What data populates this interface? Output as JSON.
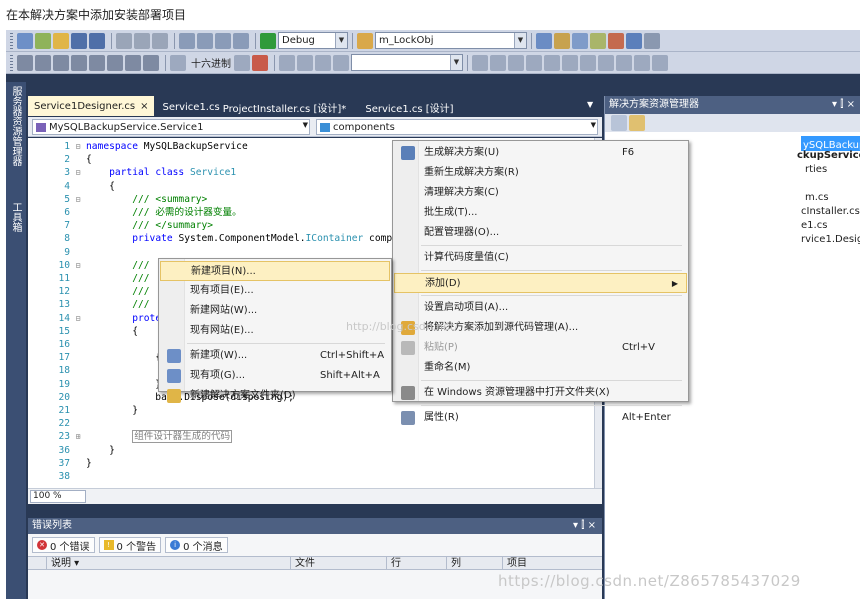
{
  "caption": "在本解决方案中添加安装部署项目",
  "toolbar": {
    "config_value": "Debug",
    "find_value": "m_LockObj",
    "hex_label": "十六进制"
  },
  "left_strip": {
    "server_explorer": "服务器资源管理器",
    "toolbox": "工具箱"
  },
  "tabs": [
    {
      "label": "Service1Designer.cs",
      "active": true,
      "close": "×"
    },
    {
      "label": "Service1.cs"
    },
    {
      "label": "ProjectInstaller.cs [设计]*"
    },
    {
      "label": "Service1.cs [设计]"
    }
  ],
  "navbar": {
    "class_combo": "MySQLBackupService.Service1",
    "member_combo": "components"
  },
  "code_lines": [
    {
      "n": "1",
      "fold": "⊟",
      "t": [
        [
          "kw",
          "namespace "
        ],
        [
          "pl",
          "MySQLBackupService"
        ]
      ]
    },
    {
      "n": "2",
      "fold": "",
      "t": [
        [
          "pl",
          "{"
        ]
      ]
    },
    {
      "n": "3",
      "fold": "⊟",
      "t": [
        [
          "pl",
          "    "
        ],
        [
          "kw",
          "partial class "
        ],
        [
          "ty",
          "Service1"
        ]
      ]
    },
    {
      "n": "4",
      "fold": "",
      "t": [
        [
          "pl",
          "    {"
        ]
      ]
    },
    {
      "n": "5",
      "fold": "⊟",
      "t": [
        [
          "pl",
          "        "
        ],
        [
          "cm",
          "/// <summary>"
        ]
      ]
    },
    {
      "n": "6",
      "fold": "",
      "t": [
        [
          "pl",
          "        "
        ],
        [
          "cm",
          "/// 必需的设计器变量。"
        ]
      ]
    },
    {
      "n": "7",
      "fold": "",
      "t": [
        [
          "pl",
          "        "
        ],
        [
          "cm",
          "/// </summary>"
        ]
      ]
    },
    {
      "n": "8",
      "fold": "",
      "t": [
        [
          "pl",
          "        "
        ],
        [
          "kw",
          "private "
        ],
        [
          "pl",
          "System.ComponentModel."
        ],
        [
          "ty",
          "IContainer"
        ],
        [
          "pl",
          " comp"
        ]
      ]
    },
    {
      "n": "9",
      "fold": "",
      "t": [
        [
          "pl",
          ""
        ]
      ]
    },
    {
      "n": "10",
      "fold": "⊟",
      "t": [
        [
          "pl",
          "        "
        ],
        [
          "cm",
          "///"
        ]
      ]
    },
    {
      "n": "11",
      "fold": "",
      "t": [
        [
          "pl",
          "        "
        ],
        [
          "cm",
          "///"
        ]
      ]
    },
    {
      "n": "12",
      "fold": "",
      "t": [
        [
          "pl",
          "        "
        ],
        [
          "cm",
          "///"
        ]
      ]
    },
    {
      "n": "13",
      "fold": "",
      "t": [
        [
          "pl",
          "        "
        ],
        [
          "cm",
          "///"
        ]
      ]
    },
    {
      "n": "14",
      "fold": "⊟",
      "t": [
        [
          "pl",
          "        "
        ],
        [
          "kw",
          "prote"
        ]
      ]
    },
    {
      "n": "15",
      "fold": "",
      "t": [
        [
          "pl",
          "        {"
        ]
      ]
    },
    {
      "n": "16",
      "fold": "",
      "t": [
        [
          "pl",
          ""
        ]
      ]
    },
    {
      "n": "17",
      "fold": "",
      "t": [
        [
          "pl",
          "            {"
        ]
      ]
    },
    {
      "n": "18",
      "fold": "",
      "t": [
        [
          "pl",
          ""
        ]
      ]
    },
    {
      "n": "19",
      "fold": "",
      "t": [
        [
          "pl",
          "            }"
        ]
      ]
    },
    {
      "n": "20",
      "fold": "",
      "t": [
        [
          "pl",
          "            base.Dispose(disposing);"
        ]
      ]
    },
    {
      "n": "21",
      "fold": "",
      "t": [
        [
          "pl",
          "        }"
        ]
      ]
    },
    {
      "n": "22",
      "fold": "",
      "t": [
        [
          "pl",
          ""
        ]
      ]
    },
    {
      "n": "23",
      "fold": "⊞",
      "t": [
        [
          "pl",
          "        "
        ],
        [
          "region",
          "组件设计器生成的代码"
        ]
      ]
    },
    {
      "n": "36",
      "fold": "",
      "t": [
        [
          "pl",
          "    }"
        ]
      ]
    },
    {
      "n": "37",
      "fold": "",
      "t": [
        [
          "pl",
          "}"
        ]
      ]
    },
    {
      "n": "38",
      "fold": "",
      "t": [
        [
          "pl",
          ""
        ]
      ]
    }
  ],
  "zoom": "100 %",
  "error_list": {
    "title": "错误列表",
    "pin": "▾ ⫿ ×",
    "errors": "0 个错误",
    "warnings": "0 个警告",
    "messages": "0 个消息",
    "columns": [
      "说明",
      "文件",
      "行",
      "列",
      "项目"
    ]
  },
  "solution_explorer": {
    "title": "解决方案资源管理器",
    "pin": "▾ ⫿ ×",
    "items": [
      {
        "text": "ySQLBackupService\" (1 个项目)"
      },
      {
        "text": "ckupService",
        "bold": true
      },
      {
        "text": "rties"
      },
      {
        "text": "m.cs"
      },
      {
        "text": "cInstaller.cs"
      },
      {
        "text": "e1.cs"
      },
      {
        "text": "rvice1.Designer.cs"
      }
    ]
  },
  "context_menu": {
    "items": [
      {
        "label": "生成解决方案(U)",
        "shortcut": "F6",
        "icon": "build-icon"
      },
      {
        "label": "重新生成解决方案(R)"
      },
      {
        "label": "清理解决方案(C)"
      },
      {
        "label": "批生成(T)..."
      },
      {
        "label": "配置管理器(O)..."
      },
      {
        "sep": true
      },
      {
        "label": "计算代码度量值(C)"
      },
      {
        "sep": true
      },
      {
        "label": "添加(D)",
        "submenu": true,
        "highlight": true
      },
      {
        "sep": true
      },
      {
        "label": "设置启动项目(A)..."
      },
      {
        "label": "将解决方案添加到源代码管理(A)...",
        "icon": "source-control-icon"
      },
      {
        "label": "粘贴(P)",
        "shortcut": "Ctrl+V",
        "disabled": true,
        "icon": "paste-icon"
      },
      {
        "label": "重命名(M)"
      },
      {
        "sep": true
      },
      {
        "label": "在 Windows 资源管理器中打开文件夹(X)",
        "icon": "open-folder-icon"
      },
      {
        "sep": true
      },
      {
        "label": "属性(R)",
        "shortcut": "Alt+Enter",
        "icon": "properties-icon"
      }
    ]
  },
  "submenu": {
    "items": [
      {
        "label": "新建项目(N)...",
        "highlight": true
      },
      {
        "label": "现有项目(E)..."
      },
      {
        "label": "新建网站(W)..."
      },
      {
        "label": "现有网站(E)..."
      },
      {
        "sep": true
      },
      {
        "label": "新建项(W)...",
        "shortcut": "Ctrl+Shift+A",
        "icon": "new-item-icon"
      },
      {
        "label": "现有项(G)...",
        "shortcut": "Shift+Alt+A",
        "icon": "existing-item-icon"
      },
      {
        "label": "新建解决方案文件夹(D)",
        "icon": "new-folder-icon"
      }
    ]
  },
  "watermark": "https://blog.csdn.net/Z865785437029",
  "watermark_short": "http://blog.csdn.net/",
  "colors": {
    "chrome": "#293955",
    "toolbar": "#cfd6e5",
    "active_tab": "#fff7d7",
    "menu_highlight": "#fdf0c2",
    "selection": "#3399ff"
  }
}
